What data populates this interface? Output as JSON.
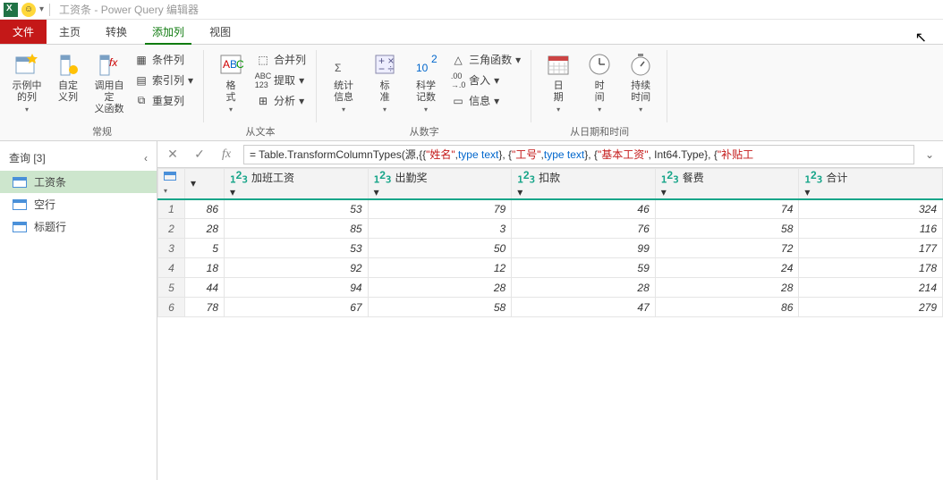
{
  "window": {
    "title": "工资条 - Power Query 编辑器"
  },
  "tabs": {
    "file": "文件",
    "items": [
      "主页",
      "转换",
      "添加列",
      "视图"
    ],
    "active_index": 2
  },
  "ribbon": {
    "group1": {
      "label": "常规",
      "btn1": "示例中\n的列",
      "btn2": "自定\n义列",
      "btn3": "调用自定\n义函数",
      "s1": "条件列",
      "s2": "索引列",
      "s3": "重复列"
    },
    "group2": {
      "label": "从文本",
      "btn1": "格\n式",
      "s1": "合并列",
      "s2": "提取",
      "s3": "分析"
    },
    "group3": {
      "label": "从数字",
      "btn1": "统计\n信息",
      "btn2": "标\n准",
      "btn3": "科学\n记数",
      "s1": "三角函数",
      "s2": "舍入",
      "s3": "信息"
    },
    "group4": {
      "label": "从日期和时间",
      "btn1": "日\n期",
      "btn2": "时\n间",
      "btn3": "持续\n时间"
    }
  },
  "sidebar": {
    "header": "查询 [3]",
    "items": [
      "工资条",
      "空行",
      "标题行"
    ],
    "active_index": 0
  },
  "formula": {
    "prefix": "= Table.TransformColumnTypes(源,{{",
    "s1": "\"姓名\"",
    "c1": ", ",
    "t1": "type text",
    "c2": "}, {",
    "s2": "\"工号\"",
    "c3": ", ",
    "t2": "type text",
    "c4": "}, {",
    "s3": "\"基本工资\"",
    "c5": ", Int64.Type}, {",
    "s4": "\"补贴工"
  },
  "table": {
    "first_col_head": "",
    "columns": [
      "加班工资",
      "出勤奖",
      "扣款",
      "餐费",
      "合计"
    ],
    "rows": [
      {
        "id": "86",
        "c": [
          53,
          79,
          46,
          74,
          324
        ]
      },
      {
        "id": "28",
        "c": [
          85,
          3,
          76,
          58,
          116
        ]
      },
      {
        "id": "5",
        "c": [
          53,
          50,
          99,
          72,
          177
        ]
      },
      {
        "id": "18",
        "c": [
          92,
          12,
          59,
          24,
          178
        ]
      },
      {
        "id": "44",
        "c": [
          94,
          28,
          28,
          28,
          214
        ]
      },
      {
        "id": "78",
        "c": [
          67,
          58,
          47,
          86,
          279
        ]
      }
    ]
  }
}
